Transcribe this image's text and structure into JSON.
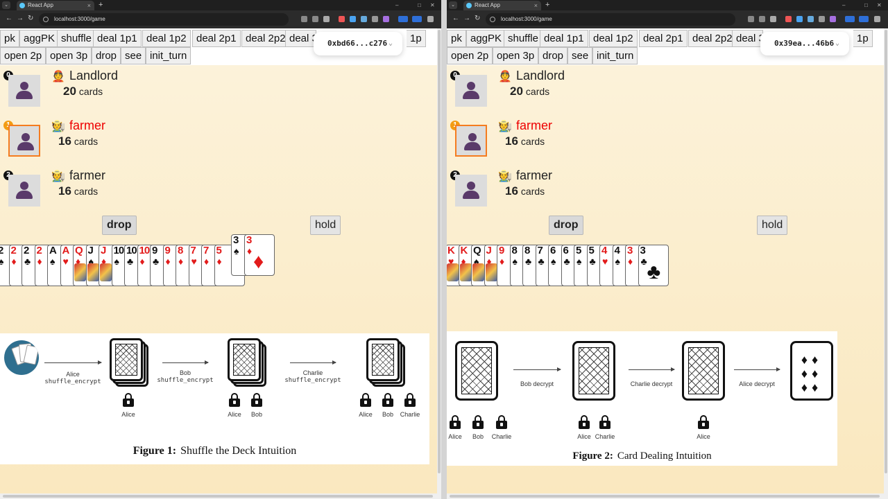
{
  "browser": {
    "tab_title": "React App",
    "url": "localhost:3000/game",
    "tab_close": "×",
    "new_tab": "+",
    "menu": "⌄",
    "nav": {
      "back": "←",
      "forward": "→",
      "reload": "↻"
    },
    "window_controls": {
      "minimize": "–",
      "maximize": "□",
      "close": "✕"
    }
  },
  "menu": {
    "row1": [
      "pk",
      "aggPK",
      "shuffle",
      "deal 1p1",
      "deal 1p2",
      "deal 2p1",
      "deal 2p2",
      "deal 3"
    ],
    "row1_tail": "1p",
    "row2": [
      "open 2p",
      "open 3p",
      "drop",
      "see",
      "init_turn"
    ]
  },
  "windows": [
    {
      "wallet": "0xbd66...c276"
    },
    {
      "wallet": "0x39ea...46b6"
    }
  ],
  "players": [
    {
      "num": "0",
      "role": "Landlord",
      "icon": "👲",
      "count": "20",
      "unit": "cards",
      "active": false
    },
    {
      "num": "1",
      "role": "farmer",
      "icon": "🧑‍🌾",
      "count": "16",
      "unit": "cards",
      "active": true
    },
    {
      "num": "2",
      "role": "farmer",
      "icon": "🧑‍🌾",
      "count": "16",
      "unit": "cards",
      "active": false
    }
  ],
  "actions": {
    "drop": "drop",
    "hold": "hold"
  },
  "hands": [
    [
      {
        "r": "2",
        "s": "♠",
        "c": "blk"
      },
      {
        "r": "2",
        "s": "♦",
        "c": "red"
      },
      {
        "r": "2",
        "s": "♣",
        "c": "blk"
      },
      {
        "r": "2",
        "s": "♦",
        "c": "red"
      },
      {
        "r": "A",
        "s": "♠",
        "c": "blk"
      },
      {
        "r": "A",
        "s": "♥",
        "c": "red"
      },
      {
        "r": "Q",
        "s": "♦",
        "c": "red",
        "face": true
      },
      {
        "r": "J",
        "s": "♠",
        "c": "blk",
        "face": true
      },
      {
        "r": "J",
        "s": "♦",
        "c": "red",
        "face": true
      },
      {
        "r": "10",
        "s": "♠",
        "c": "blk"
      },
      {
        "r": "10",
        "s": "♣",
        "c": "blk"
      },
      {
        "r": "10",
        "s": "♦",
        "c": "red"
      },
      {
        "r": "9",
        "s": "♣",
        "c": "blk"
      },
      {
        "r": "9",
        "s": "♦",
        "c": "red"
      },
      {
        "r": "8",
        "s": "♦",
        "c": "red"
      },
      {
        "r": "7",
        "s": "♥",
        "c": "red"
      },
      {
        "r": "7",
        "s": "♦",
        "c": "red"
      },
      {
        "r": "5",
        "s": "♦",
        "c": "red"
      },
      {
        "r": "3",
        "s": "♠",
        "c": "blk"
      },
      {
        "r": "3",
        "s": "♦",
        "c": "red"
      }
    ],
    [
      {
        "r": "K",
        "s": "♥",
        "c": "red",
        "face": true
      },
      {
        "r": "K",
        "s": "♦",
        "c": "red",
        "face": true
      },
      {
        "r": "Q",
        "s": "♠",
        "c": "blk",
        "face": true
      },
      {
        "r": "J",
        "s": "♦",
        "c": "red",
        "face": true
      },
      {
        "r": "9",
        "s": "♦",
        "c": "red"
      },
      {
        "r": "8",
        "s": "♠",
        "c": "blk"
      },
      {
        "r": "8",
        "s": "♣",
        "c": "blk"
      },
      {
        "r": "7",
        "s": "♣",
        "c": "blk"
      },
      {
        "r": "6",
        "s": "♠",
        "c": "blk"
      },
      {
        "r": "6",
        "s": "♣",
        "c": "blk"
      },
      {
        "r": "5",
        "s": "♠",
        "c": "blk"
      },
      {
        "r": "5",
        "s": "♣",
        "c": "blk"
      },
      {
        "r": "4",
        "s": "♥",
        "c": "red"
      },
      {
        "r": "4",
        "s": "♠",
        "c": "blk"
      },
      {
        "r": "3",
        "s": "♦",
        "c": "red"
      },
      {
        "r": "3",
        "s": "♣",
        "c": "blk"
      }
    ]
  ],
  "figure1": {
    "label": "Figure 1:",
    "caption": "Shuffle the Deck Intuition",
    "arrows": [
      {
        "line1": "Alice",
        "line2": "shuffle_encrypt"
      },
      {
        "line1": "Bob",
        "line2": "shuffle_encrypt"
      },
      {
        "line1": "Charlie",
        "line2": "shuffle_encrypt"
      }
    ],
    "locks": [
      "Alice",
      "Alice",
      "Bob",
      "Alice",
      "Bob",
      "Charlie"
    ]
  },
  "figure2": {
    "label": "Figure 2:",
    "caption": "Card Dealing Intuition",
    "arrows": [
      "Bob decrypt",
      "Charlie decrypt",
      "Alice decrypt"
    ],
    "locks": [
      "Alice",
      "Bob",
      "Charlie",
      "Alice",
      "Charlie",
      "Alice"
    ],
    "pips": "♦♦ ♦♦ ♦♦"
  },
  "colors": {
    "accent": "#f57c1f",
    "active_role": "#e00000",
    "page_bg": "#fae8bf"
  }
}
